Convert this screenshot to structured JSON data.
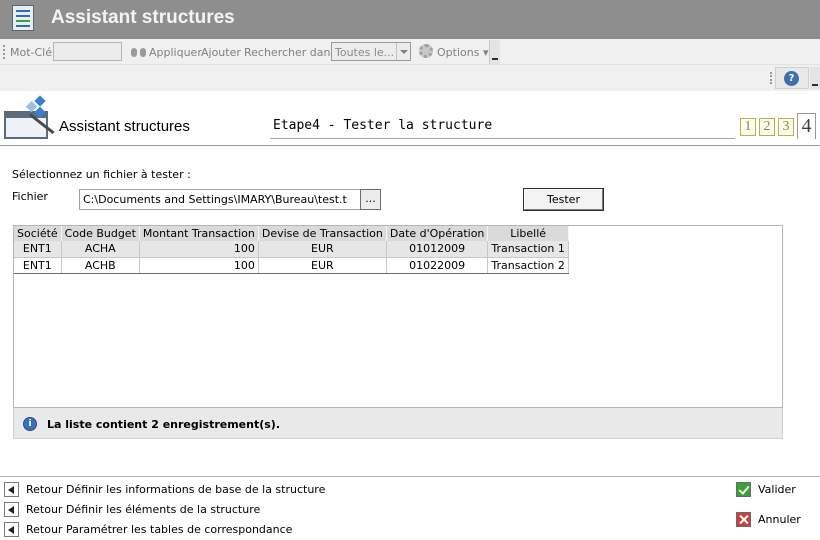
{
  "window": {
    "title": "Assistant structures"
  },
  "toolbar": {
    "keyword_label": "Mot-Clé",
    "keyword_value": "",
    "apply_label": "Appliquer",
    "add_label": "Ajouter",
    "search_in_label": "Rechercher dans",
    "search_in_value": "Toutes le...",
    "options_label": "Options"
  },
  "header": {
    "title": "Assistant structures",
    "step_title": "Etape4 - Tester la structure",
    "steps": [
      "1",
      "2",
      "3",
      "4"
    ],
    "current_step": "4"
  },
  "form": {
    "instruction": "Sélectionnez un fichier à tester :",
    "file_label": "Fichier",
    "file_value": "C:\\Documents and Settings\\IMARY\\Bureau\\test.t",
    "browse_label": "...",
    "test_button": "Tester"
  },
  "grid": {
    "columns": [
      "Société",
      "Code Budget",
      "Montant Transaction",
      "Devise de Transaction",
      "Date d'Opération",
      "Libellé"
    ],
    "rows": [
      [
        "ENT1",
        "ACHA",
        "100",
        "EUR",
        "01012009",
        "Transaction 1"
      ],
      [
        "ENT1",
        "ACHB",
        "100",
        "EUR",
        "01022009",
        "Transaction 2"
      ]
    ],
    "status": "La liste contient  2 enregistrement(s)."
  },
  "footer": {
    "links": [
      "Retour Définir les informations de base de la structure",
      "Retour Définir les éléments de la structure",
      "Retour Paramétrer les tables de correspondance"
    ],
    "validate_label": "Valider",
    "cancel_label": "Annuler"
  },
  "colors": {
    "titlebar": "#8e8e8e",
    "step_accent": "#b9b23c",
    "validate": "#39a13a",
    "cancel": "#c9423a",
    "info": "#3d6fb8"
  }
}
